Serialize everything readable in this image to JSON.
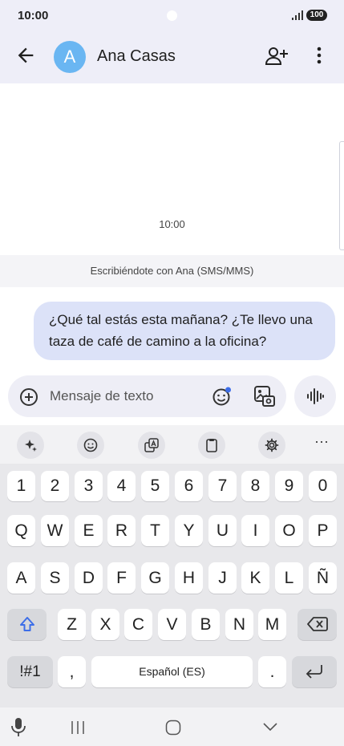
{
  "status": {
    "time": "10:00",
    "battery": "100"
  },
  "header": {
    "avatar_letter": "A",
    "contact_name": "Ana Casas"
  },
  "conversation": {
    "timestamp": "10:00",
    "info": "Escribiéndote con Ana (SMS/MMS)",
    "message": "¿Qué tal estás esta mañana? ¿Te llevo una taza de café de camino a la oficina?"
  },
  "compose": {
    "placeholder": "Mensaje de texto"
  },
  "keyboard": {
    "more": "···",
    "number_row": [
      "1",
      "2",
      "3",
      "4",
      "5",
      "6",
      "7",
      "8",
      "9",
      "0"
    ],
    "row1": [
      "Q",
      "W",
      "E",
      "R",
      "T",
      "Y",
      "U",
      "I",
      "O",
      "P"
    ],
    "row2": [
      "A",
      "S",
      "D",
      "F",
      "G",
      "H",
      "J",
      "K",
      "L",
      "Ñ"
    ],
    "row3": [
      "Z",
      "X",
      "C",
      "V",
      "B",
      "N",
      "M"
    ],
    "symbols_key": "!#1",
    "comma_key": ",",
    "space_key": "Español (ES)",
    "period_key": "."
  }
}
